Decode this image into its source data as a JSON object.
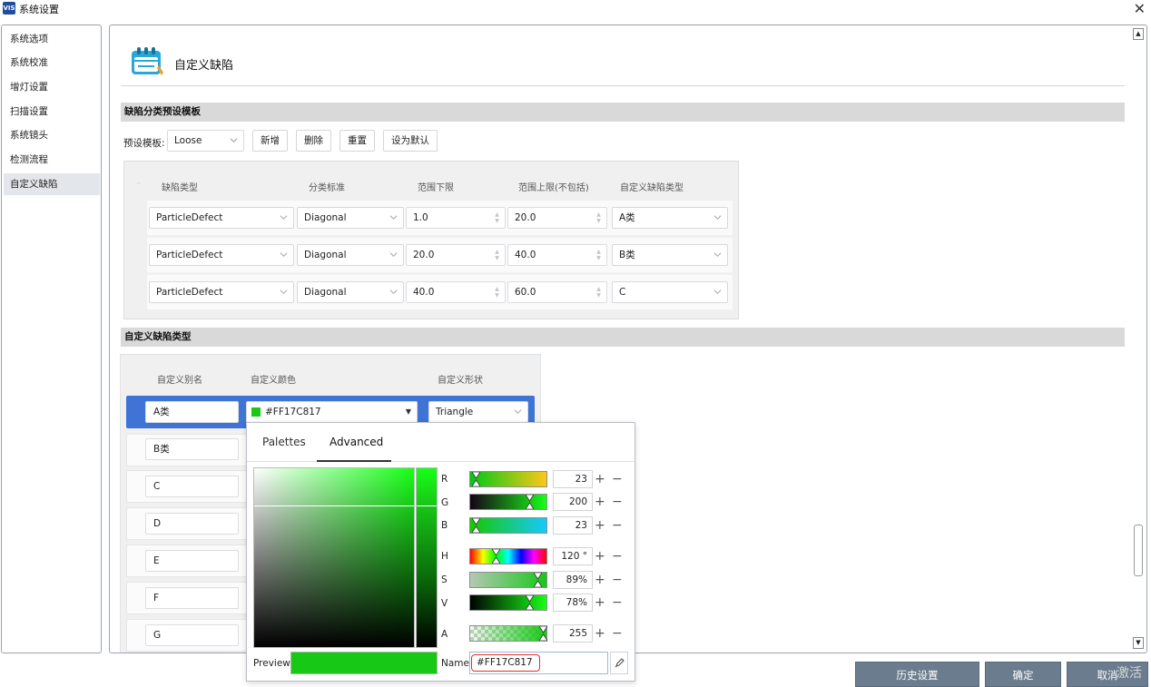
{
  "window": {
    "icon_text": "VIS",
    "title": "系统设置"
  },
  "sidebar": {
    "items": [
      {
        "label": "系统选项"
      },
      {
        "label": "系统校准"
      },
      {
        "label": "增灯设置"
      },
      {
        "label": "扫描设置"
      },
      {
        "label": "系统镜头"
      },
      {
        "label": "检测流程"
      },
      {
        "label": "自定义缺陷"
      }
    ],
    "active_index": 6
  },
  "page": {
    "title": "自定义缺陷"
  },
  "preset_section": {
    "header": "缺陷分类预设模板",
    "preset_label": "预设模板:",
    "preset_value": "Loose",
    "buttons": {
      "add": "新增",
      "delete": "删除",
      "reset": "重置",
      "set_default": "设为默认"
    },
    "columns": [
      "缺陷类型",
      "分类标准",
      "范围下限",
      "范围上限(不包括)",
      "自定义缺陷类型"
    ],
    "rows": [
      {
        "defect_type": "ParticleDefect",
        "standard": "Diagonal",
        "min": "1.0",
        "max": "20.0",
        "custom_type": "A类"
      },
      {
        "defect_type": "ParticleDefect",
        "standard": "Diagonal",
        "min": "20.0",
        "max": "40.0",
        "custom_type": "B类"
      },
      {
        "defect_type": "ParticleDefect",
        "standard": "Diagonal",
        "min": "40.0",
        "max": "60.0",
        "custom_type": "C"
      }
    ]
  },
  "custom_section": {
    "header": "自定义缺陷类型",
    "columns": [
      "自定义别名",
      "自定义颜色",
      "自定义形状"
    ],
    "rows": [
      {
        "alias": "A类",
        "color": "#FF17C817",
        "shape": "Triangle",
        "selected": true
      },
      {
        "alias": "B类"
      },
      {
        "alias": "C"
      },
      {
        "alias": "D"
      },
      {
        "alias": "E"
      },
      {
        "alias": "F"
      },
      {
        "alias": "G"
      }
    ]
  },
  "color_picker": {
    "tabs": [
      "Palettes",
      "Advanced"
    ],
    "active_tab": "Advanced",
    "channels": {
      "R": "23",
      "G": "200",
      "B": "23",
      "H": "120 °",
      "S": "89%",
      "V": "78%",
      "A": "255"
    },
    "current_color": "#17C817",
    "preview_label": "Preview",
    "name_label": "Name",
    "name_value": "#FF17C817"
  },
  "footer": {
    "history": "历史设置",
    "ok": "确定",
    "cancel": "取消"
  },
  "watermark": "激活"
}
